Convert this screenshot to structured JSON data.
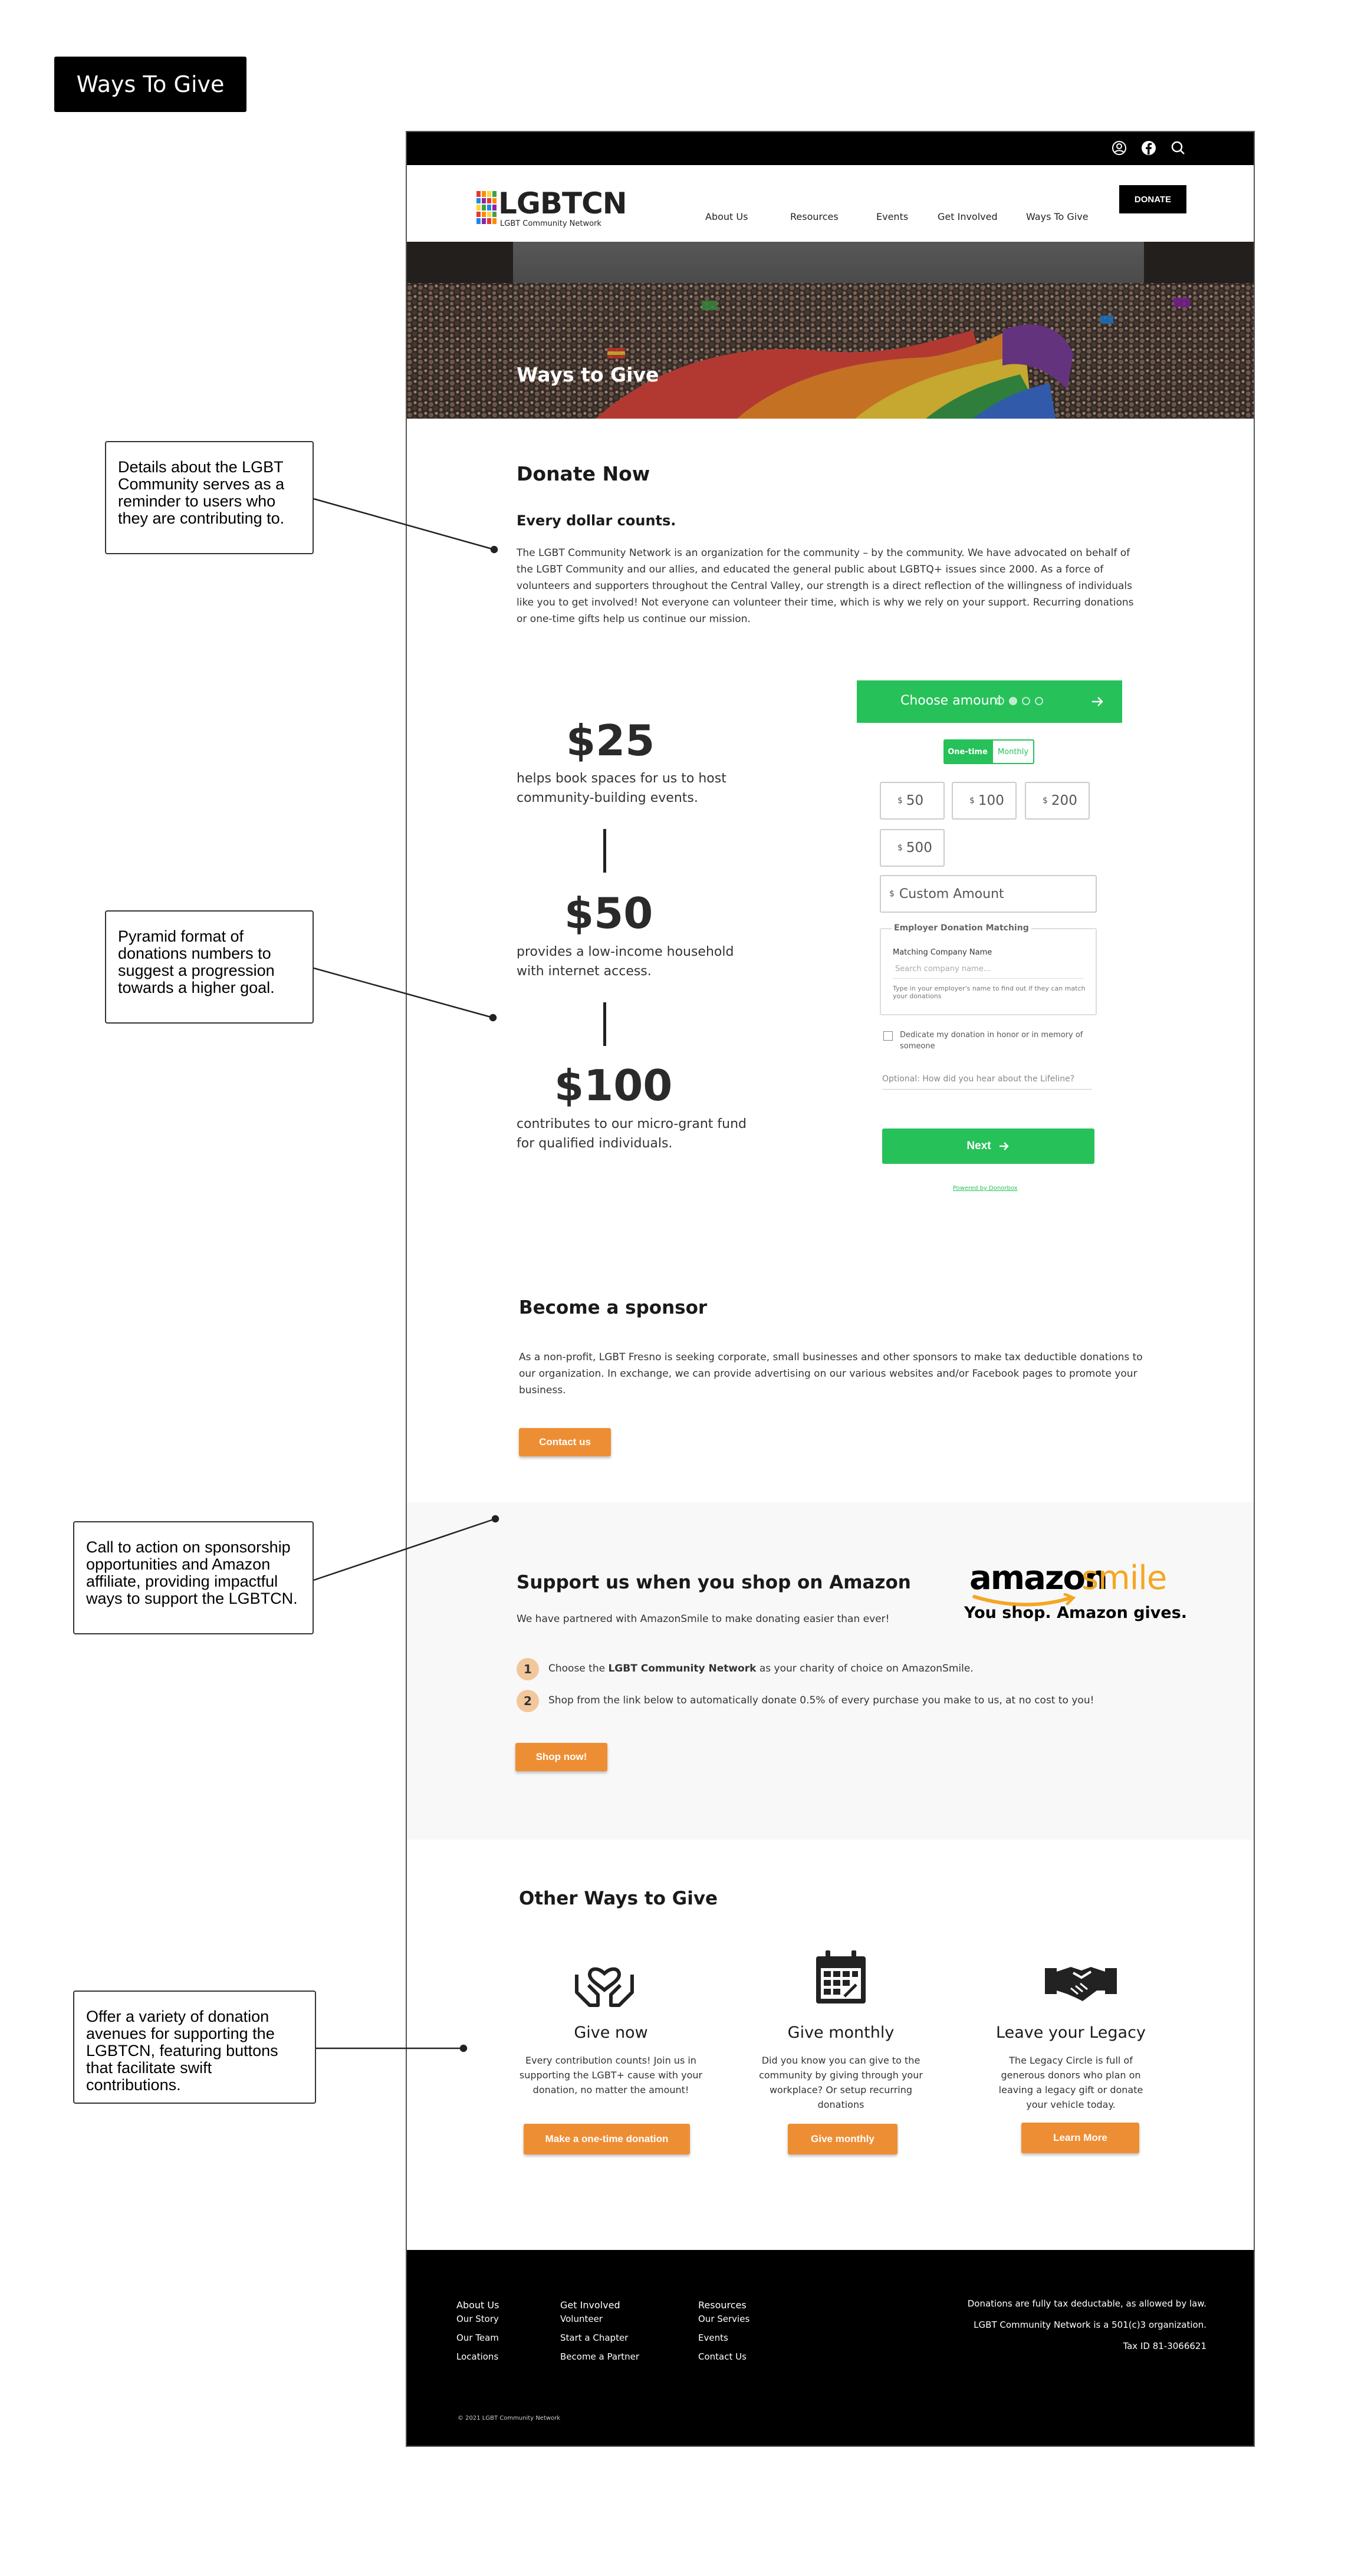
{
  "page_title": "Ways To Give",
  "nav": {
    "logo_text": "LGBTCN",
    "logo_sub": "LGBT Community Network",
    "links": [
      "About Us",
      "Resources",
      "Events",
      "Get Involved",
      "Ways To Give"
    ],
    "donate": "DONATE",
    "icons": [
      "user-icon",
      "facebook-icon",
      "search-icon"
    ]
  },
  "hero": {
    "title": "Ways to Give"
  },
  "donate_now": {
    "heading": "Donate Now",
    "subheading": "Every dollar counts.",
    "body": "The LGBT Community Network is an organization for the community – by the community. We have advocated on behalf of the LGBT Community and our allies, and educated the general public about LGBTQ+ issues since 2000. As a force of volunteers and supporters throughout the Central Valley, our strength is a direct reflection of the willingness of individuals like you to get involved! Not everyone can volunteer their time, which is why we rely on your support. Recurring donations or one-time gifts help us continue our mission."
  },
  "pyramid": [
    {
      "amount": "$25",
      "desc": "helps book spaces for us to host community-building events."
    },
    {
      "amount": "$50",
      "desc": "provides a low-income household with internet access."
    },
    {
      "amount": "$100",
      "desc": "contributes to our micro-grant fund for qualified individuals."
    }
  ],
  "widget": {
    "header": "Choose amount",
    "one_time": "One-time",
    "monthly": "Monthly",
    "currency": "$",
    "amounts": [
      "50",
      "100",
      "200",
      "500"
    ],
    "custom_placeholder": "Custom Amount",
    "employer_legend": "Employer Donation Matching",
    "company_label": "Matching Company Name",
    "company_placeholder": "Search company name...",
    "company_help": "Type in your employer's name to find out if they can match your donations",
    "dedicate": "Dedicate my donation in honor or in memory of someone",
    "hear_placeholder": "Optional: How did you hear about the Lifeline?",
    "next": "Next",
    "powered": "Powered by Donorbox"
  },
  "sponsor": {
    "heading": "Become a sponsor",
    "body": "As a non-profit, LGBT Fresno is seeking corporate, small businesses and other sponsors to make tax deductible donations to our organization. In exchange, we can provide advertising on our various websites and/or Facebook pages to promote your business.",
    "button": "Contact us"
  },
  "amazon": {
    "heading": "Support us when you shop on Amazon",
    "intro": "We have partnered with AmazonSmile to make donating easier than ever!",
    "logo_amazon": "amazon",
    "logo_smile": "smile",
    "tagline": "You shop. Amazon gives.",
    "steps": [
      {
        "num": "1",
        "pre": "Choose the ",
        "bold": "LGBT Community Network",
        "post": " as your charity of choice on AmazonSmile."
      },
      {
        "num": "2",
        "text": "Shop from the link below to automatically donate 0.5% of every purchase you make to us, at no cost to you!"
      }
    ],
    "button": "Shop now!"
  },
  "other": {
    "heading": "Other Ways to Give",
    "cards": [
      {
        "icon": "heart-hands-icon",
        "title": "Give now",
        "text": "Every contribution counts! Join us in supporting the LGBT+ cause with your donation, no matter the amount!",
        "button": "Make a one-time donation"
      },
      {
        "icon": "calendar-icon",
        "title": "Give monthly",
        "text": "Did you know you can give to the community by giving through your workplace? Or setup recurring donations",
        "button": "Give monthly"
      },
      {
        "icon": "handshake-icon",
        "title": "Leave your Legacy",
        "text": "The Legacy Circle is full of generous donors who plan on leaving a legacy gift or donate your vehicle today.",
        "button": "Learn More"
      }
    ]
  },
  "footer": {
    "cols": [
      {
        "head": "About Us",
        "links": [
          "Our Story",
          "Our Team",
          "Locations"
        ]
      },
      {
        "head": "Get Involved",
        "links": [
          "Volunteer",
          "Start a Chapter",
          "Become a Partner"
        ]
      },
      {
        "head": "Resources",
        "links": [
          "Our Servies",
          "Events",
          "Contact Us"
        ]
      }
    ],
    "right": [
      "Donations are fully tax deductable, as allowed by law.",
      "LGBT Community Network is a 501(c)3 organization.",
      "Tax ID 81-3066621"
    ],
    "copyright": "© 2021 LGBT Community Network"
  },
  "annotations": [
    "Details about the LGBT Community serves as a reminder to users who they are contributing to.",
    "Pyramid format of donations numbers to suggest a progression towards a higher goal.",
    "Call to action on sponsorship opportunities and Amazon affiliate, providing impactful ways to support the LGBTCN.",
    "Offer a variety of donation avenues for supporting the LGBTCN, featuring buttons that facilitate swift contributions."
  ],
  "colors": {
    "green": "#26c159",
    "orange": "#ee8e34",
    "amazon_orange": "#f5a623",
    "black": "#000000"
  }
}
